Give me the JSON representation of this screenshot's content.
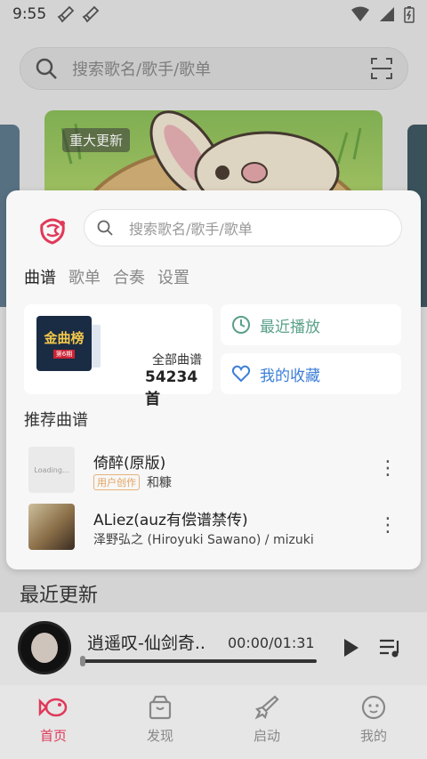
{
  "status": {
    "time": "9:55"
  },
  "bg_search": {
    "placeholder": "搜索歌名/歌手/歌单"
  },
  "banner": {
    "tag": "重大更新"
  },
  "card": {
    "search_placeholder": "搜索歌名/歌手/歌单",
    "tabs": [
      {
        "label": "曲谱"
      },
      {
        "label": "歌单"
      },
      {
        "label": "合奏"
      },
      {
        "label": "设置"
      }
    ],
    "all_scores": {
      "label": "全部曲谱",
      "count": "54234首",
      "album_title": "金曲榜",
      "album_sub": "第6期"
    },
    "recent_play": "最近播放",
    "favorites": "我的收藏",
    "recommend_title": "推荐曲谱",
    "songs": [
      {
        "name": "倚醉(原版)",
        "badge": "用户创作",
        "artist": "和糠",
        "cover_text": "Loading..."
      },
      {
        "name": "ALiez(auz有偿谱禁传)",
        "badge": "",
        "artist": "泽野弘之 (Hiroyuki Sawano) / mizuki",
        "cover_text": ""
      }
    ]
  },
  "section_title": "最近更新",
  "player": {
    "title": "逍遥叹-仙剑奇..",
    "time": "00:00/01:31",
    "progress": 0
  },
  "nav": [
    {
      "label": "首页",
      "icon": "fish-icon"
    },
    {
      "label": "发现",
      "icon": "box-icon"
    },
    {
      "label": "启动",
      "icon": "rocket-icon"
    },
    {
      "label": "我的",
      "icon": "face-icon"
    }
  ],
  "colors": {
    "accent": "#e0395a",
    "recent": "#5aa08a",
    "favorite": "#3c7fd8"
  }
}
